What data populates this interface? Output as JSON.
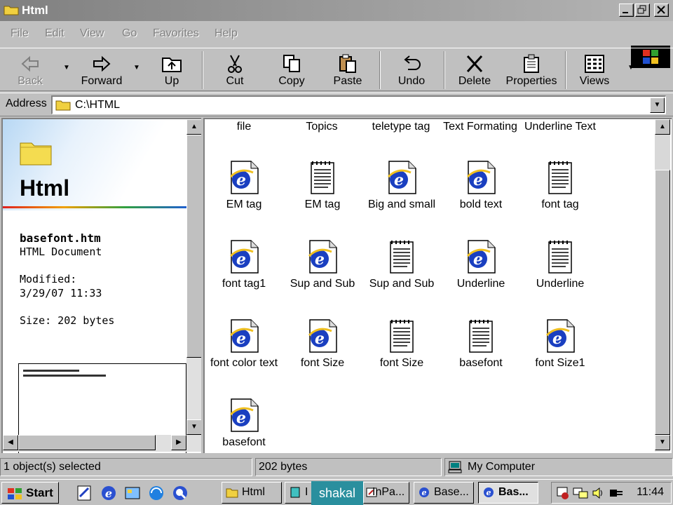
{
  "window": {
    "title": "Html",
    "controls": {
      "minimize": "minimize",
      "maximize": "maximize",
      "close": "close"
    }
  },
  "menu": [
    "File",
    "Edit",
    "View",
    "Go",
    "Favorites",
    "Help"
  ],
  "toolbar": {
    "back": "Back",
    "forward": "Forward",
    "up": "Up",
    "cut": "Cut",
    "copy": "Copy",
    "paste": "Paste",
    "undo": "Undo",
    "delete": "Delete",
    "properties": "Properties",
    "views": "Views"
  },
  "address": {
    "label": "Address",
    "value": "C:\\HTML"
  },
  "left_pane": {
    "folder_title": "Html",
    "file_name": "basefont.htm",
    "file_type": "HTML Document",
    "modified_label": "Modified:",
    "modified_value": "3/29/07 11:33",
    "size": "Size: 202 bytes"
  },
  "header_labels": [
    "file",
    "Topics",
    "teletype tag",
    "Text Formating",
    "Underline Text"
  ],
  "files": [
    {
      "label": "EM tag",
      "type": "ie"
    },
    {
      "label": "EM tag",
      "type": "notepad"
    },
    {
      "label": "Big and small",
      "type": "ie"
    },
    {
      "label": "bold text",
      "type": "ie"
    },
    {
      "label": "font tag",
      "type": "notepad"
    },
    {
      "label": "font tag1",
      "type": "ie"
    },
    {
      "label": "Sup and Sub",
      "type": "ie"
    },
    {
      "label": "Sup and Sub",
      "type": "notepad"
    },
    {
      "label": "Underline",
      "type": "ie"
    },
    {
      "label": "Underline",
      "type": "notepad"
    },
    {
      "label": "font color text",
      "type": "ie"
    },
    {
      "label": "font Size",
      "type": "ie"
    },
    {
      "label": "font Size",
      "type": "notepad"
    },
    {
      "label": "basefont",
      "type": "notepad"
    },
    {
      "label": "font Size1",
      "type": "ie"
    },
    {
      "label": "basefont",
      "type": "ie"
    }
  ],
  "status": {
    "selection": "1 object(s) selected",
    "size": "202 bytes",
    "zone": "My Computer"
  },
  "taskbar": {
    "start": "Start",
    "items": [
      "Html",
      "I",
      "InPa...",
      "Base...",
      "Bas..."
    ],
    "overlay_text": "shakal",
    "clock": "11:44"
  },
  "colors": {
    "ie_blue": "#1a3fc0",
    "title_gradient_start": "#808080"
  }
}
